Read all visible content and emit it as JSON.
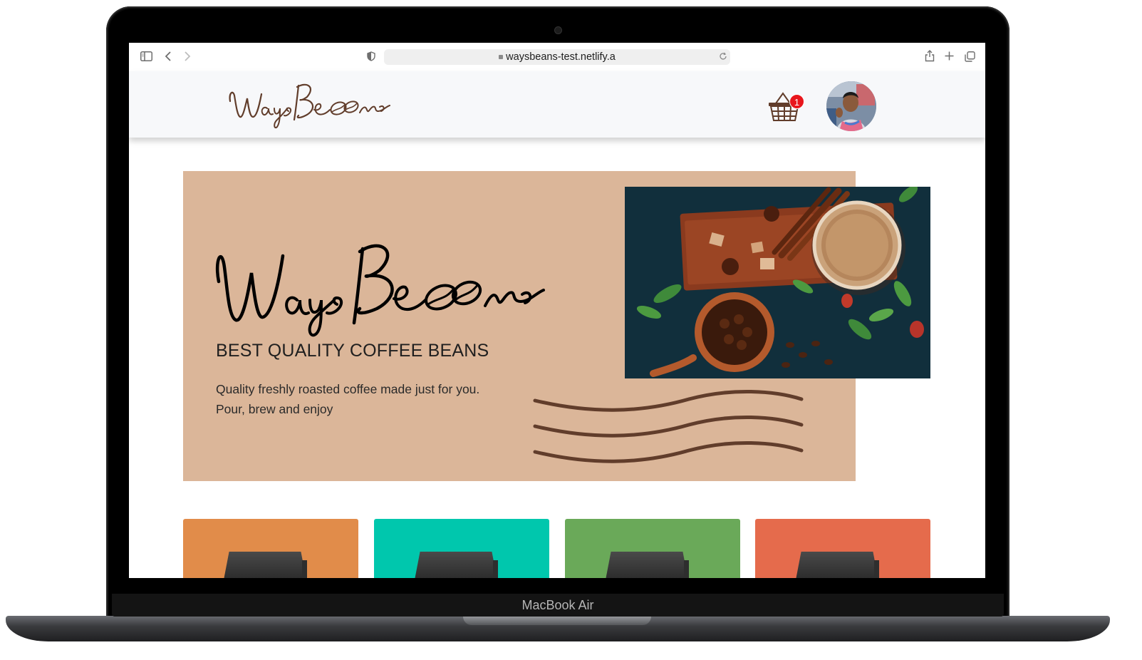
{
  "device": {
    "model_label": "MacBook Air"
  },
  "browser": {
    "url": "waysbeans-test.netlify.a",
    "icons": [
      "sidebar-icon",
      "back-icon",
      "forward-icon",
      "privacy-shield-icon",
      "lock-icon",
      "reload-icon",
      "share-icon",
      "new-tab-icon",
      "tabs-overview-icon"
    ]
  },
  "nav": {
    "logo_text": "WaysBeans",
    "cart": {
      "icon": "basket-icon",
      "badge_count": "1"
    },
    "avatar": {
      "icon": "user-avatar"
    }
  },
  "hero": {
    "logo_text": "WaysBeans",
    "headline": "BEST QUALITY COFFEE BEANS",
    "description_line1": "Quality freshly roasted coffee made just for you.",
    "description_line2": "Pour, brew and enjoy",
    "image": "coffee-cup-beans-cinnamon-photo"
  },
  "products": [
    {
      "color": "#e18c4a"
    },
    {
      "color": "#00c7ad"
    },
    {
      "color": "#6aa959"
    },
    {
      "color": "#e56b4c"
    }
  ],
  "colors": {
    "brand_brown": "#613d2b",
    "hero_bg": "#dbb699",
    "nav_bg": "#f7f8fa",
    "badge_red": "#e8161c"
  }
}
